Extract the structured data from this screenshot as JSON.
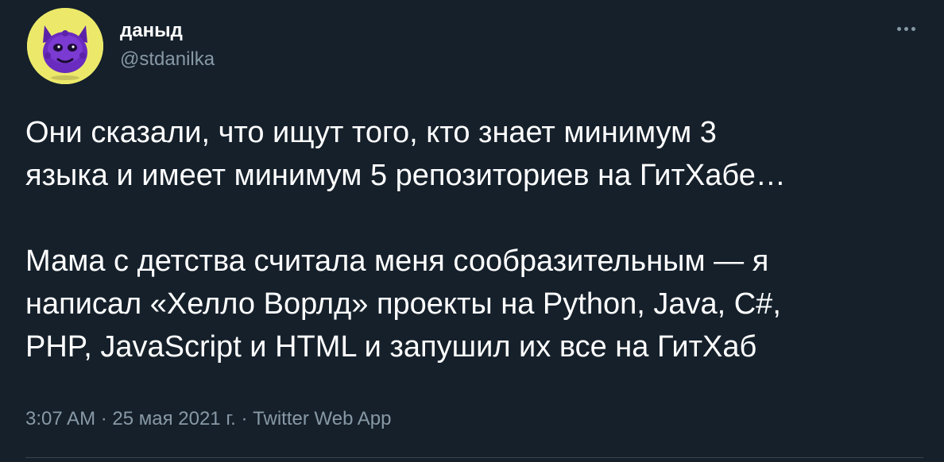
{
  "author": {
    "name": "даныд",
    "handle": "@stdanilka",
    "avatar_icon": "purple-creature-avatar"
  },
  "tweet": {
    "lines_p1": [
      "Они сказали, что ищут того, кто знает минимум 3",
      "языка и имеет минимум 5 репозиториев на ГитХабе…"
    ],
    "lines_p2": [
      "Мама с детства считала меня сообразительным — я",
      "написал «Хелло Ворлд» проекты на Python, Java, C#,",
      "PHP, JavaScript и HTML и запушил их все на ГитХаб"
    ]
  },
  "meta": {
    "time": "3:07 AM",
    "separator": " · ",
    "date": "25 мая 2021 г.",
    "source": "Twitter Web App"
  },
  "more_icon": "more-dots-icon",
  "colors": {
    "background": "#15202b",
    "text": "#ffffff",
    "secondary": "#8899a6",
    "avatar_bg": "#ece96a",
    "avatar_creature": "#6a2bbf"
  }
}
